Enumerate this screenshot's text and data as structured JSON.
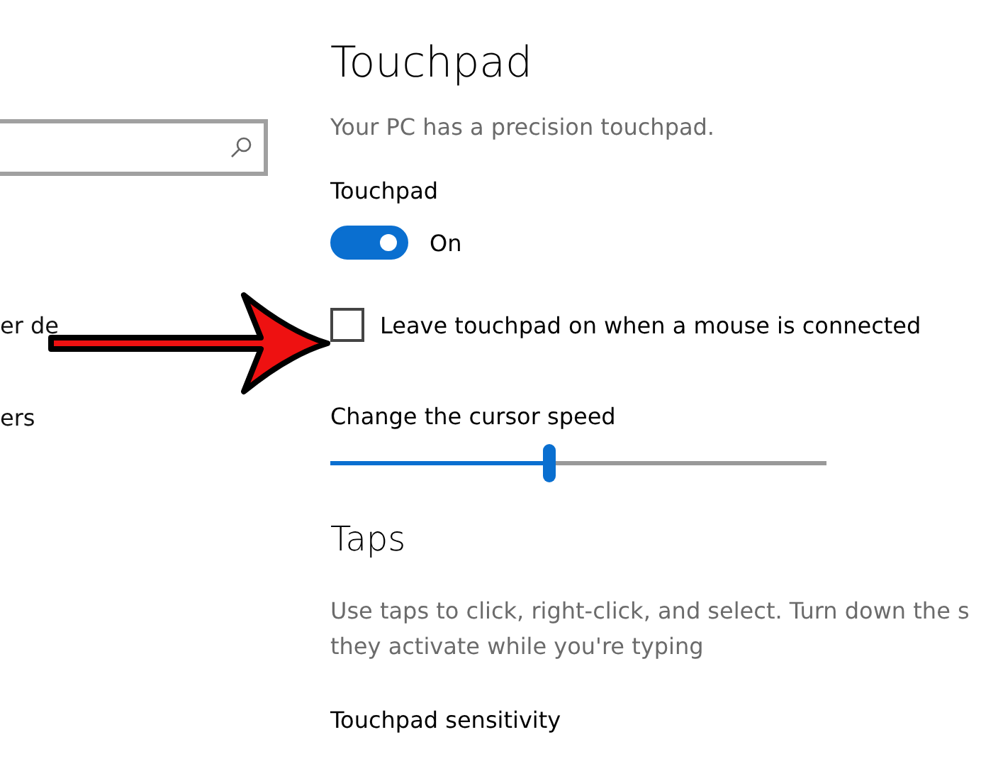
{
  "sidebar": {
    "items": [
      {
        "label": "er de"
      },
      {
        "label": "ers"
      }
    ]
  },
  "page": {
    "title": "Touchpad",
    "subtitle": "Your PC has a precision touchpad.",
    "touchpad_toggle": {
      "label": "Touchpad",
      "on": true,
      "state_text": "On"
    },
    "leave_on_checkbox": {
      "label": "Leave touchpad on when a mouse is connected",
      "checked": false
    },
    "cursor_speed": {
      "label": "Change the cursor speed",
      "level": 0.44
    },
    "taps": {
      "title": "Taps",
      "description_lines": [
        "Use taps to click, right-click, and select. Turn down the s",
        "they activate while you're typing"
      ],
      "sensitivity_label": "Touchpad sensitivity"
    }
  }
}
